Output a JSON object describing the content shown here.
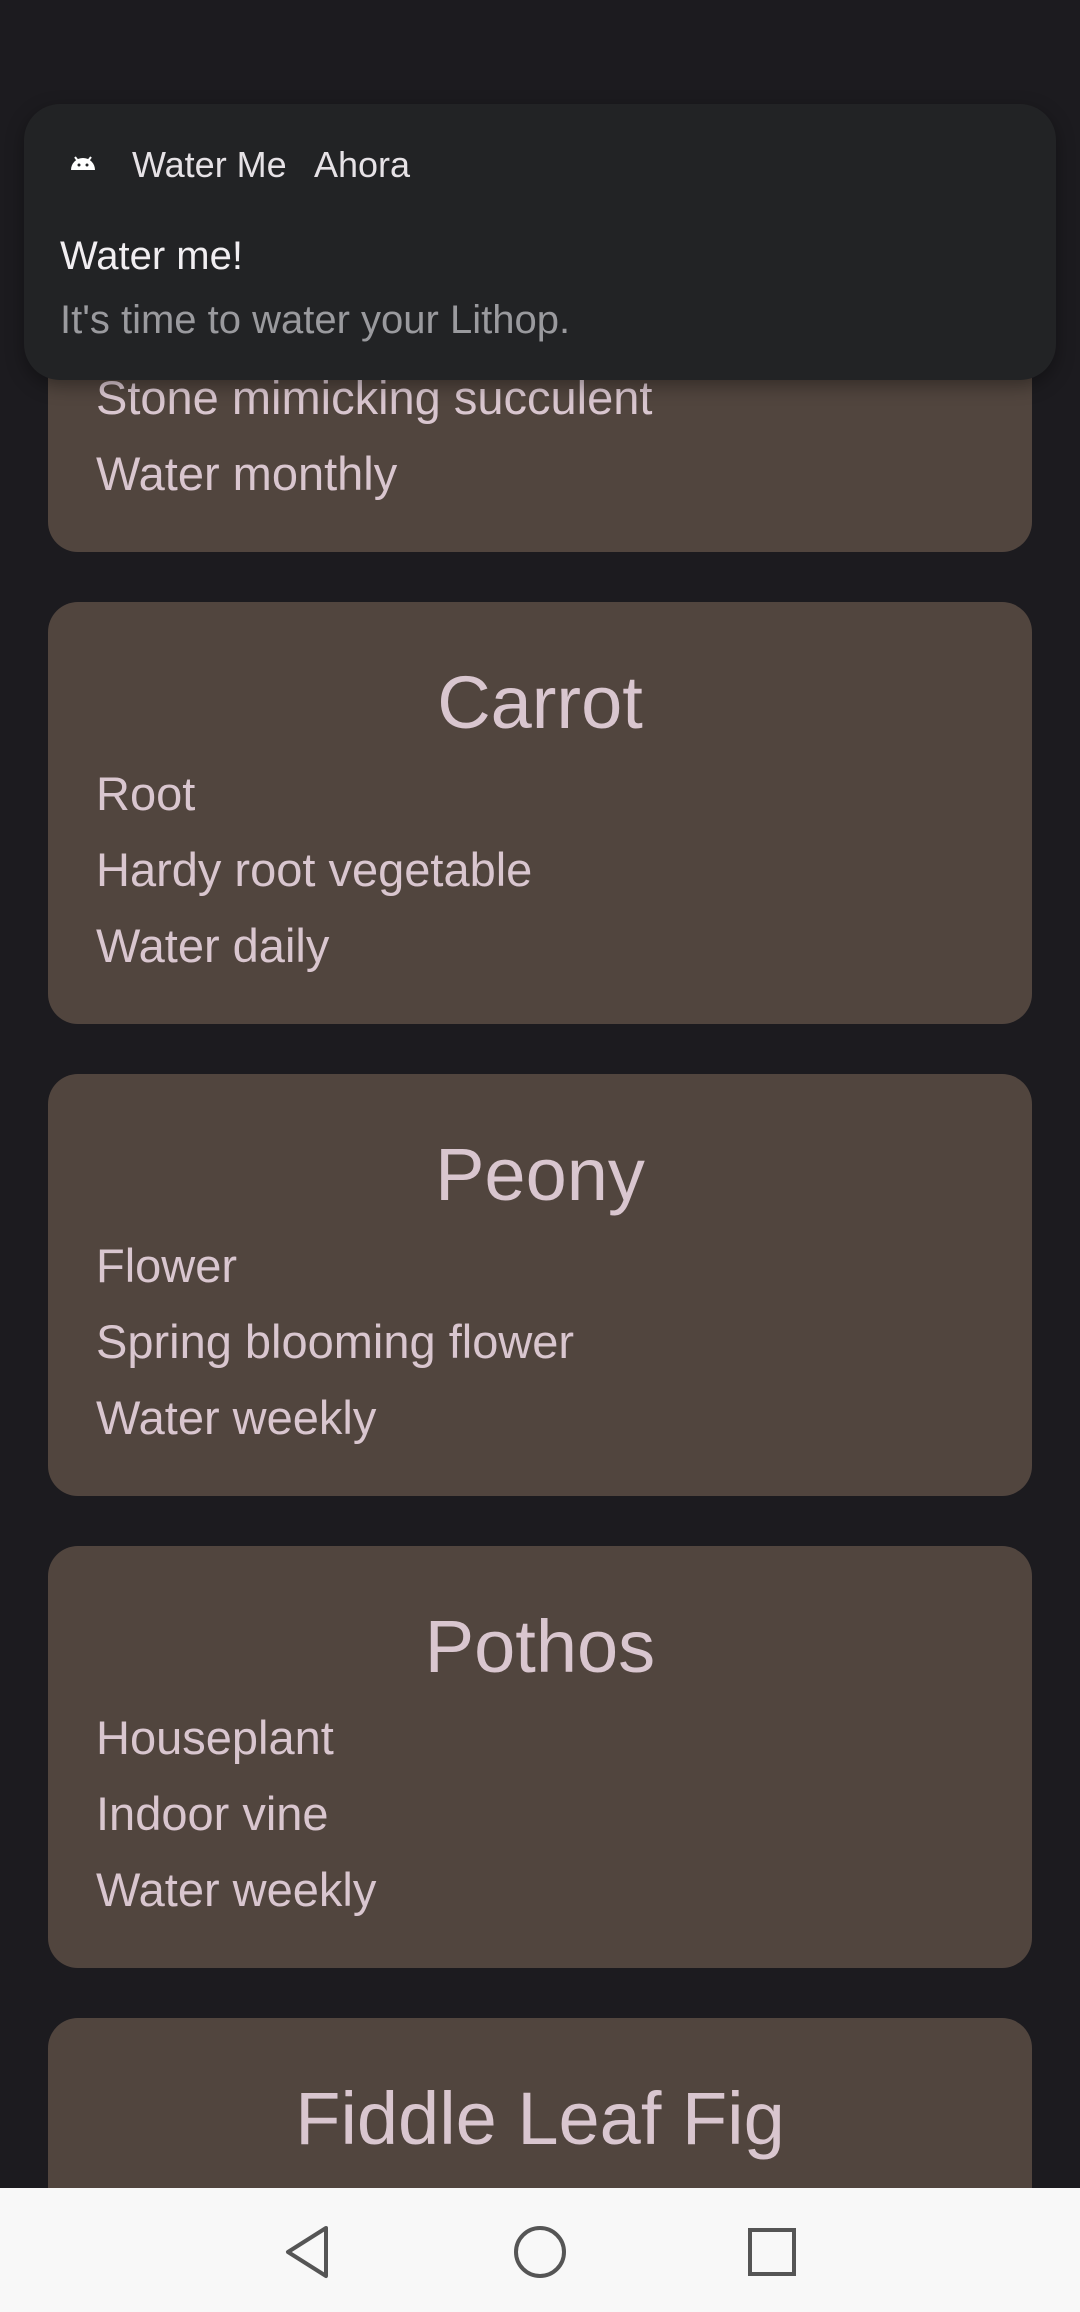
{
  "notification": {
    "app_name": "Water Me",
    "time": "Ahora",
    "title": "Water me!",
    "text": "It's time to water your Lithop.",
    "icon": "android-icon"
  },
  "plants": [
    {
      "name": "",
      "type": "Stone mimicking succulent",
      "description": "Water monthly",
      "schedule": ""
    },
    {
      "name": "Carrot",
      "type": "Root",
      "description": "Hardy root vegetable",
      "schedule": "Water daily"
    },
    {
      "name": "Peony",
      "type": "Flower",
      "description": "Spring blooming flower",
      "schedule": "Water weekly"
    },
    {
      "name": "Pothos",
      "type": "Houseplant",
      "description": "Indoor vine",
      "schedule": "Water weekly"
    },
    {
      "name": "Fiddle Leaf Fig",
      "type": "",
      "description": "",
      "schedule": ""
    }
  ],
  "nav": {
    "back": "back-icon",
    "home": "home-icon",
    "recents": "recents-icon"
  },
  "colors": {
    "background": "#1c1b1f",
    "card": "#51453e",
    "card_text": "#d9c6cf",
    "notification_bg": "#222325",
    "navbar_bg": "#f8f8f8"
  }
}
